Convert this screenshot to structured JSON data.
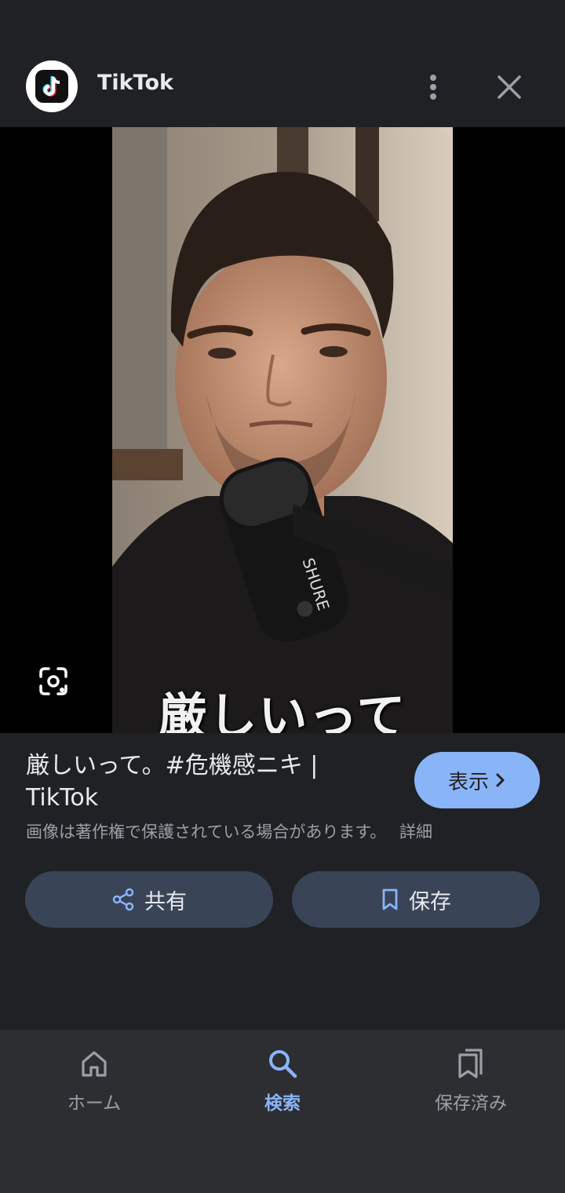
{
  "header": {
    "source_name": "TikTok",
    "logo_icon": "tiktok-logo",
    "more_icon": "more-vert-icon",
    "close_icon": "close-icon"
  },
  "image": {
    "caption_overlay": "厳しいって"
  },
  "result": {
    "title_line1": "厳しいって。#危機感ニキ |",
    "title_line2": "TikTok",
    "visit_label": "表示",
    "copyright_text": "画像は著作権で保護されている場合があります。",
    "detail_link": "詳細"
  },
  "actions": {
    "share_label": "共有",
    "save_label": "保存"
  },
  "bottom_nav": {
    "items": [
      {
        "label": "ホーム",
        "icon": "home-icon",
        "active": false
      },
      {
        "label": "検索",
        "icon": "search-icon",
        "active": true
      },
      {
        "label": "保存済み",
        "icon": "saved-icon",
        "active": false
      }
    ]
  },
  "colors": {
    "background": "#202124",
    "accent": "#8ab4f8",
    "action_button": "#394457",
    "nav_background": "#2d2e31"
  }
}
